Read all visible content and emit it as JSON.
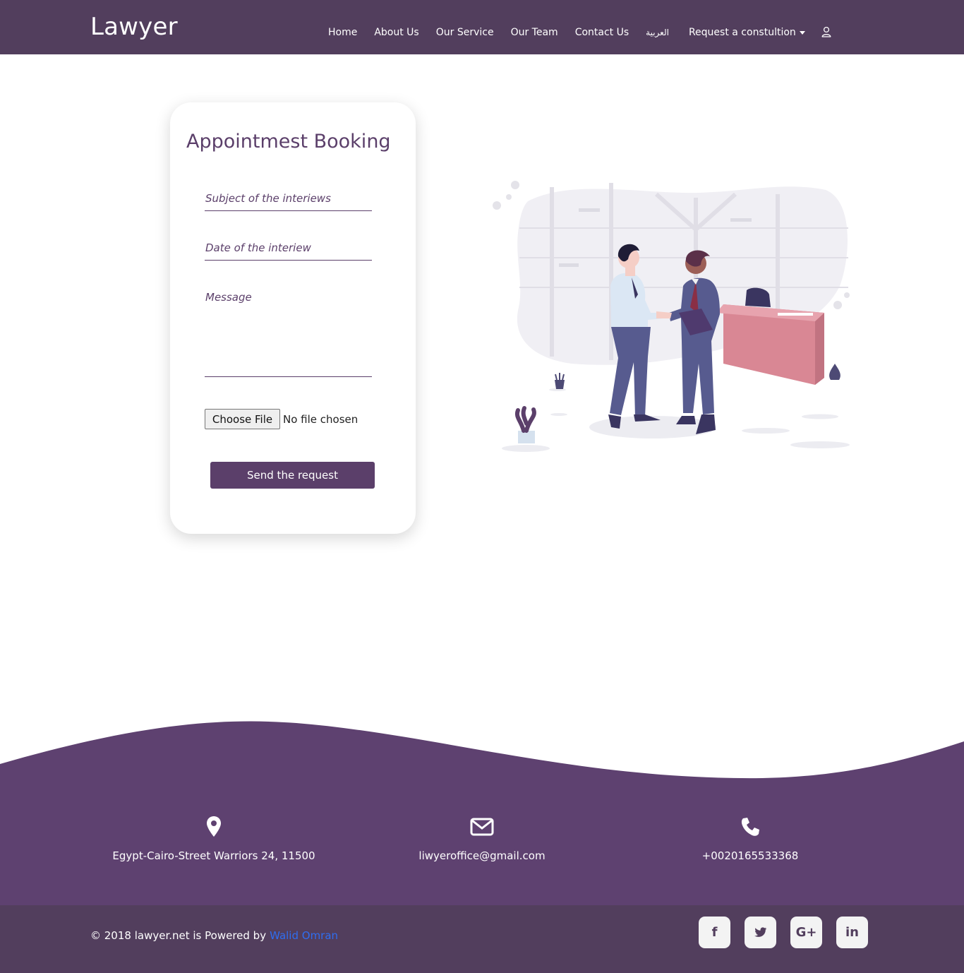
{
  "navbar": {
    "brand": "Lawyer",
    "links": [
      "Home",
      "About Us",
      "Our Service",
      "Our Team",
      "Contact Us",
      "العربية"
    ],
    "dropdown_label": "Request a constultion",
    "user_icon": "user-icon"
  },
  "booking": {
    "title": "Appointmest Booking",
    "subject_placeholder": "Subject of the interiews",
    "date_placeholder": "Date of the interiew",
    "message_placeholder": "Message",
    "file_button": "Choose File",
    "file_status": "No file chosen",
    "submit_label": "Send the request"
  },
  "contact": {
    "address": "Egypt-Cairo-Street Warriors 24, 11500",
    "email": "liwyeroffice@gmail.com",
    "phone": "+0020165533368",
    "address_icon": "map-marker-icon",
    "email_icon": "envelope-icon",
    "phone_icon": "phone-icon"
  },
  "footer": {
    "copyright": "© 2018 lawyer.net is Powered by",
    "author": "Walid Omran",
    "social": [
      {
        "icon": "facebook-icon",
        "glyph": "f"
      },
      {
        "icon": "twitter-icon",
        "glyph": "🐦"
      },
      {
        "icon": "google-plus-icon",
        "glyph": "G+"
      },
      {
        "icon": "linkedin-icon",
        "glyph": "in"
      }
    ]
  },
  "colors": {
    "nav_bg": "#523e5d",
    "accent": "#5b3f6a",
    "footer_wave": "#5e4170",
    "link": "#2f6df0"
  }
}
